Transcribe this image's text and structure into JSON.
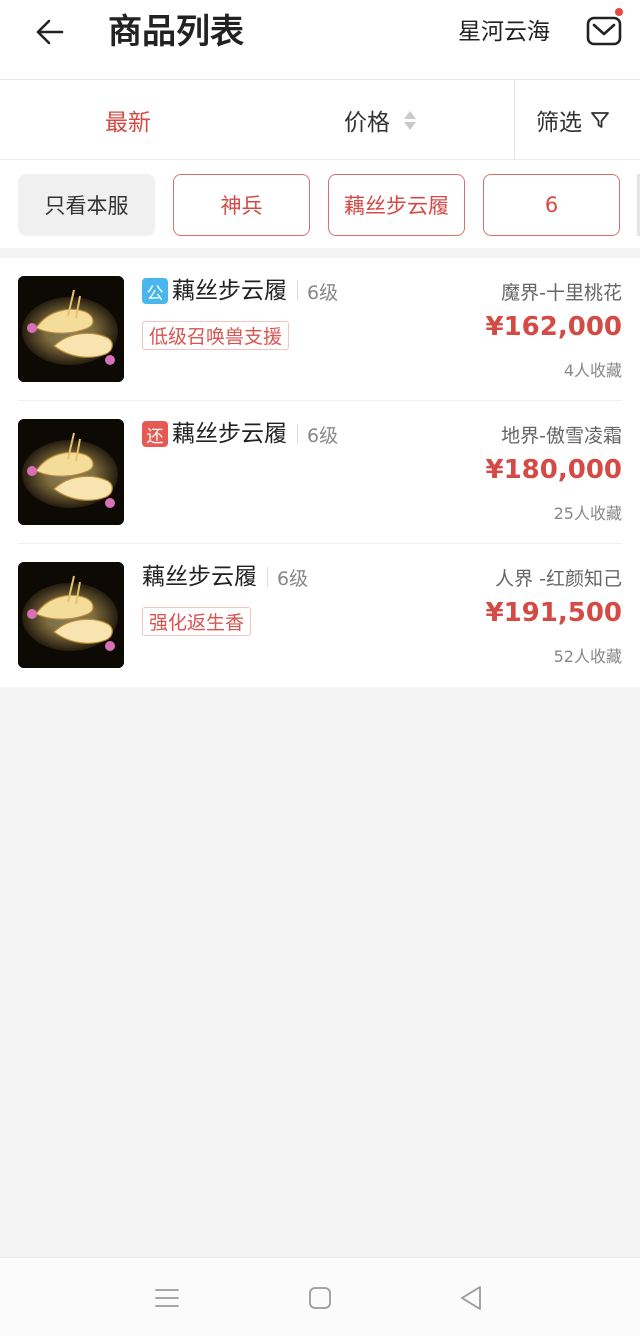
{
  "header": {
    "back_icon": "arrow-left-icon",
    "title": "商品列表",
    "server": "星河云海",
    "mail_icon": "mail-icon",
    "mail_has_unread": true
  },
  "sort_bar": {
    "latest": "最新",
    "price": "价格",
    "filter": "筛选",
    "active": "latest",
    "accent_color": "#d44a45"
  },
  "chips": [
    {
      "label": "只看本服",
      "style": "gray"
    },
    {
      "label": "神兵",
      "style": "red"
    },
    {
      "label": "藕丝步云履",
      "style": "red"
    },
    {
      "label": "6",
      "style": "red"
    }
  ],
  "items": [
    {
      "badge": "公",
      "badge_color": "#4ab6ee",
      "name": "藕丝步云履",
      "level": "6级",
      "tag": "低级召唤兽支援",
      "server": "魔界-十里桃花",
      "price": "¥162,000",
      "favorites": "4人收藏"
    },
    {
      "badge": "还",
      "badge_color": "#e55a52",
      "name": "藕丝步云履",
      "level": "6级",
      "tag": "",
      "server": "地界-傲雪凌霜",
      "price": "¥180,000",
      "favorites": "25人收藏"
    },
    {
      "badge": "",
      "badge_color": "",
      "name": "藕丝步云履",
      "level": "6级",
      "tag": "强化返生香",
      "server": "人界 -红颜知己",
      "price": "¥191,500",
      "favorites": "52人收藏"
    }
  ],
  "navbar": {
    "menu_icon": "menu-icon",
    "home_icon": "home-square-icon",
    "back_icon": "back-triangle-icon"
  }
}
